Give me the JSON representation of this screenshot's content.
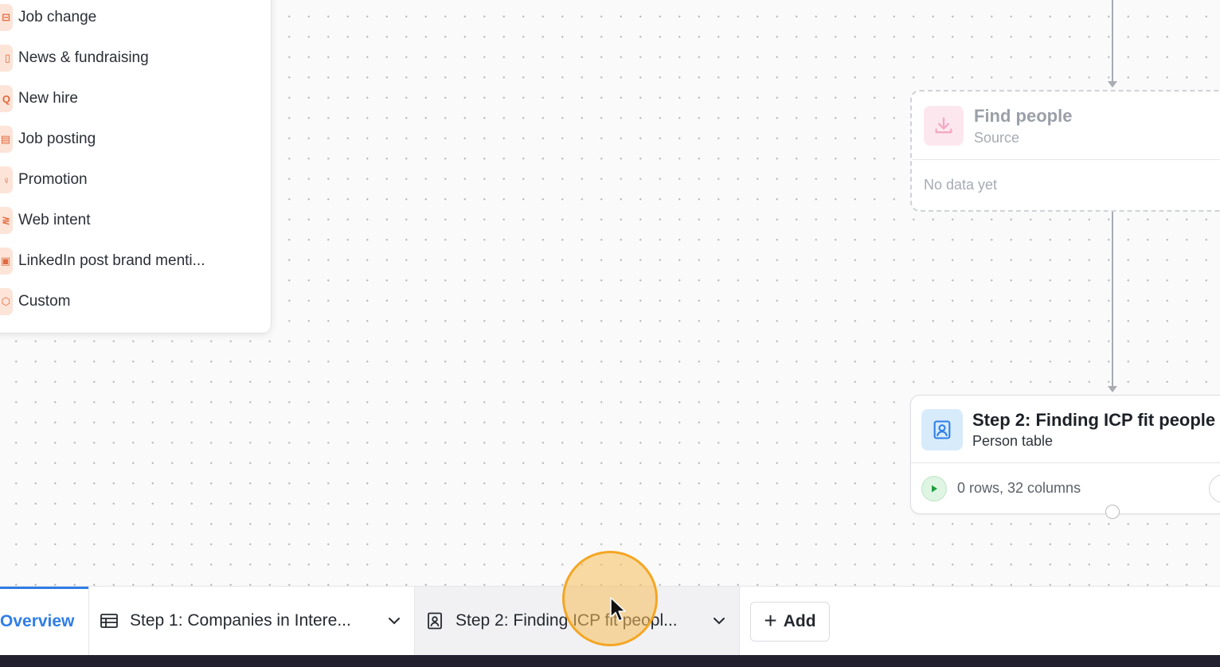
{
  "signal_menu": {
    "items": [
      {
        "label": "Job change",
        "icon": "briefcase-icon"
      },
      {
        "label": "News & fundraising",
        "icon": "newspaper-icon"
      },
      {
        "label": "New hire",
        "icon": "search-person-icon"
      },
      {
        "label": "Job posting",
        "icon": "clipboard-icon"
      },
      {
        "label": "Promotion",
        "icon": "award-icon"
      },
      {
        "label": "Web intent",
        "icon": "cursor-click-icon"
      },
      {
        "label": "LinkedIn post brand menti...",
        "icon": "linkedin-icon"
      },
      {
        "label": "Custom",
        "icon": "box-icon"
      }
    ]
  },
  "nodes": {
    "find_people": {
      "title": "Find people",
      "subtitle": "Source",
      "status": "No data yet",
      "icon": "download-icon",
      "icon_color": "#f2a9c4"
    },
    "step2": {
      "title": "Step 2: Finding ICP fit people",
      "subtitle": "Person table",
      "summary": "0 rows, 32 columns",
      "icon": "person-card-icon",
      "icon_color": "#2f7ee6"
    }
  },
  "tabs": {
    "overview": "Overview",
    "step1": "Step 1: Companies in Intere...",
    "step2": "Step 2: Finding ICP fit peopl...",
    "add": "Add"
  },
  "colors": {
    "accent": "#2f7ee6",
    "menu_icon": "#e0693e",
    "run_green": "#22a845",
    "cursor_highlight": "#f4a623"
  }
}
